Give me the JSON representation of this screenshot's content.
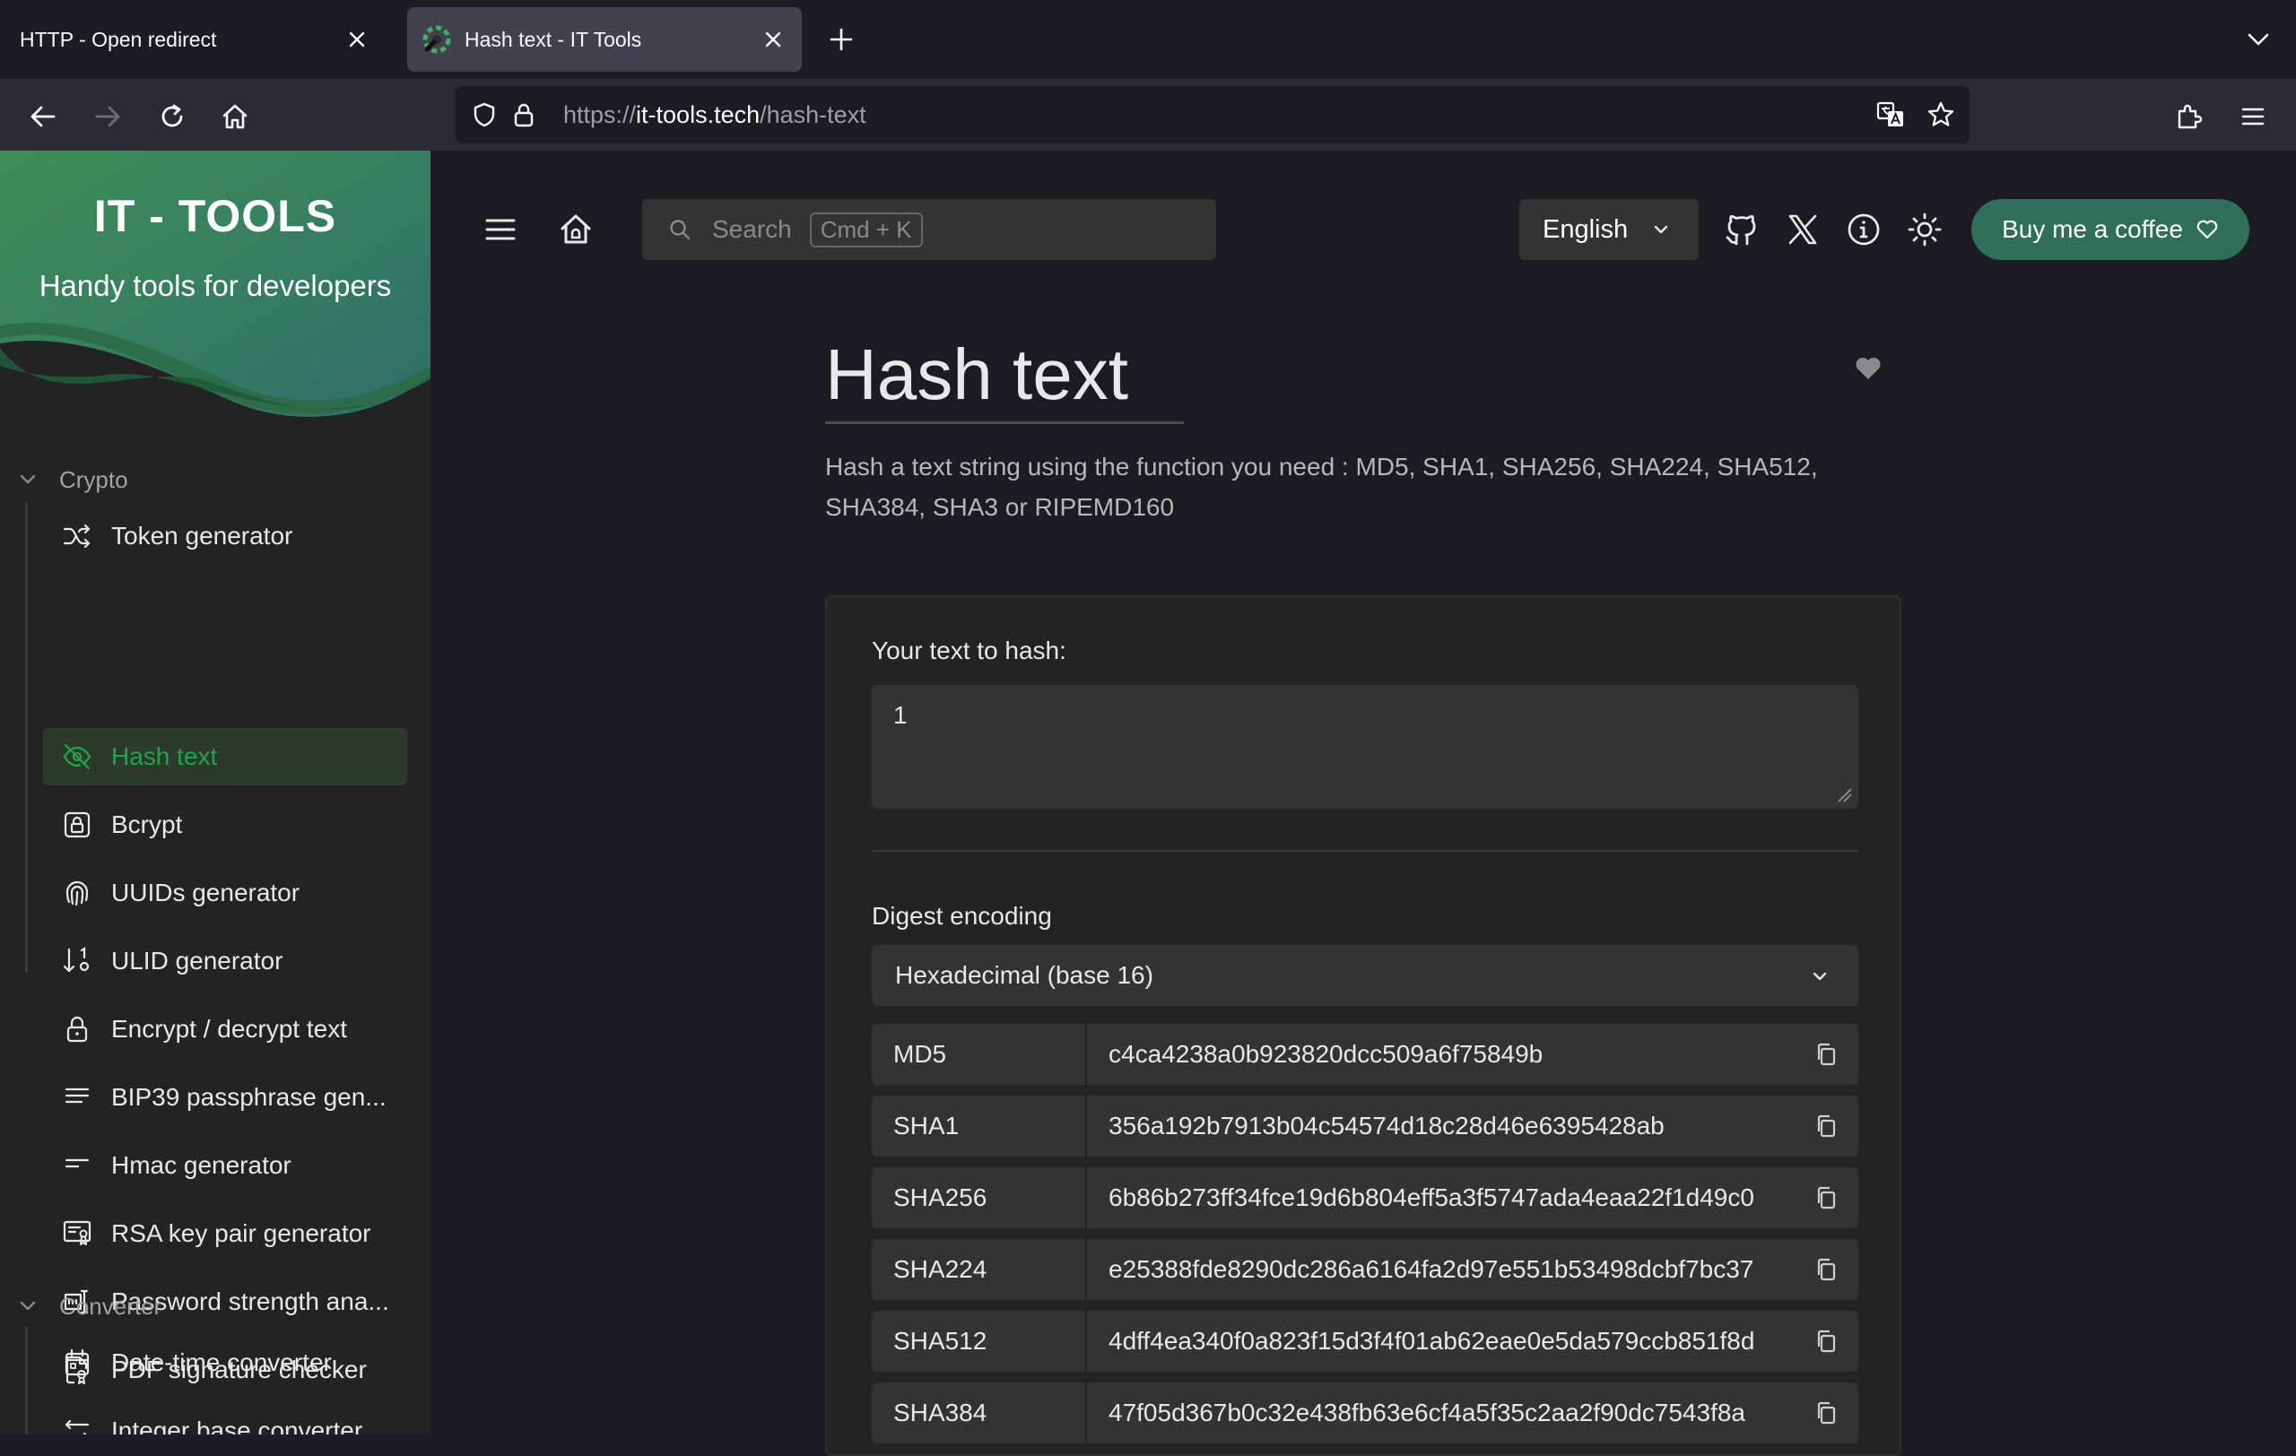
{
  "browser": {
    "tabs": [
      {
        "title": "HTTP - Open redirect",
        "active": false
      },
      {
        "title": "Hash text - IT Tools",
        "active": true
      }
    ],
    "url": {
      "scheme": "https://",
      "host": "it-tools.tech",
      "path": "/hash-text"
    }
  },
  "sidebar": {
    "title": "IT - TOOLS",
    "subtitle": "Handy tools for developers",
    "groups": [
      {
        "label": "Crypto",
        "items": [
          {
            "label": "Token generator",
            "icon": "shuffle-icon"
          },
          {
            "label": "Hash text",
            "icon": "eye-off-icon",
            "active": true
          },
          {
            "label": "Bcrypt",
            "icon": "lock-square-icon"
          },
          {
            "label": "UUIDs generator",
            "icon": "fingerprint-icon"
          },
          {
            "label": "ULID generator",
            "icon": "sort-numbers-icon"
          },
          {
            "label": "Encrypt / decrypt text",
            "icon": "lock-icon"
          },
          {
            "label": "BIP39 passphrase gen...",
            "icon": "align-justified-icon"
          },
          {
            "label": "Hmac generator",
            "icon": "short-text-icon"
          },
          {
            "label": "RSA key pair generator",
            "icon": "certificate-icon"
          },
          {
            "label": "Password strength ana...",
            "icon": "password-icon"
          },
          {
            "label": "PDF signature checker",
            "icon": "file-certificate-icon"
          }
        ]
      },
      {
        "label": "Converter",
        "items": [
          {
            "label": "Date-time converter",
            "icon": "calendar-icon"
          },
          {
            "label": "Integer base converter",
            "icon": "arrows-left-right-icon"
          }
        ]
      }
    ]
  },
  "header": {
    "search_placeholder": "Search",
    "search_shortcut": "Cmd + K",
    "language": "English",
    "coffee_label": "Buy me a coffee"
  },
  "tool": {
    "title": "Hash text",
    "description": "Hash a text string using the function you need : MD5, SHA1, SHA256, SHA224, SHA512, SHA384, SHA3 or RIPEMD160",
    "input_label": "Your text to hash:",
    "input_value": "1",
    "encoding_label": "Digest encoding",
    "encoding_value": "Hexadecimal (base 16)",
    "hashes": [
      {
        "name": "MD5",
        "value": "c4ca4238a0b923820dcc509a6f75849b"
      },
      {
        "name": "SHA1",
        "value": "356a192b7913b04c54574d18c28d46e6395428ab"
      },
      {
        "name": "SHA256",
        "value": "6b86b273ff34fce19d6b804eff5a3f5747ada4eaa22f1d49c0"
      },
      {
        "name": "SHA224",
        "value": "e25388fde8290dc286a6164fa2d97e551b53498dcbf7bc37"
      },
      {
        "name": "SHA512",
        "value": "4dff4ea340f0a823f15d3f4f01ab62eae0e5da579ccb851f8d"
      },
      {
        "name": "SHA384",
        "value": "47f05d367b0c32e438fb63e6cf4a5f35c2aa2f90dc7543f8a"
      }
    ]
  },
  "colors": {
    "accent_green": "#1ea54c",
    "coffee_button": "#2f6e58",
    "sidebar_hero_start": "#3e8e57",
    "sidebar_hero_end": "#2f6f6a"
  }
}
